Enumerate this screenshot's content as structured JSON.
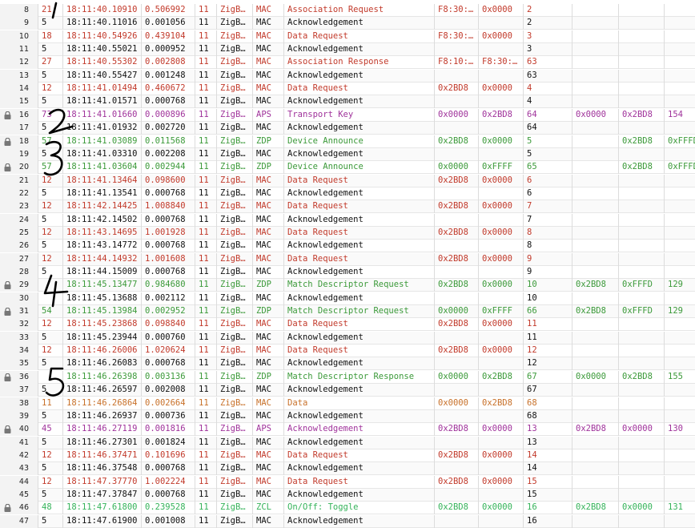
{
  "colors": {
    "mac_red": "#c23a2b",
    "mac_black": "#111111",
    "aps_purple": "#a0339b",
    "zdp_green": "#3c9a3a",
    "data_orange": "#c8712a",
    "zcl_green": "#35b35a",
    "ink": "#000000"
  },
  "icons": {
    "locked": "padlock-icon"
  },
  "rows": [
    {
      "idx": "8",
      "len": "21",
      "time": "18:11:40.10910",
      "dur": "0.506992",
      "ch": "11",
      "proto": "ZigB…",
      "layer": "MAC",
      "msg": "Association Request",
      "src": "F8:30:…",
      "dst": "0x0000",
      "seq": "2",
      "nsrc": "",
      "ndst": "",
      "rad": "",
      "color": "#c23a2b",
      "lock": false
    },
    {
      "idx": "9",
      "len": "5",
      "time": "18:11:40.11016",
      "dur": "0.001056",
      "ch": "11",
      "proto": "ZigB…",
      "layer": "MAC",
      "msg": "Acknowledgement",
      "src": "",
      "dst": "",
      "seq": "2",
      "nsrc": "",
      "ndst": "",
      "rad": "",
      "color": "#111111",
      "lock": false
    },
    {
      "idx": "10",
      "len": "18",
      "time": "18:11:40.54926",
      "dur": "0.439104",
      "ch": "11",
      "proto": "ZigB…",
      "layer": "MAC",
      "msg": "Data Request",
      "src": "F8:30:…",
      "dst": "0x0000",
      "seq": "3",
      "nsrc": "",
      "ndst": "",
      "rad": "",
      "color": "#c23a2b",
      "lock": false
    },
    {
      "idx": "11",
      "len": "5",
      "time": "18:11:40.55021",
      "dur": "0.000952",
      "ch": "11",
      "proto": "ZigB…",
      "layer": "MAC",
      "msg": "Acknowledgement",
      "src": "",
      "dst": "",
      "seq": "3",
      "nsrc": "",
      "ndst": "",
      "rad": "",
      "color": "#111111",
      "lock": false
    },
    {
      "idx": "12",
      "len": "27",
      "time": "18:11:40.55302",
      "dur": "0.002808",
      "ch": "11",
      "proto": "ZigB…",
      "layer": "MAC",
      "msg": "Association Response",
      "src": "F8:10:…",
      "dst": "F8:30:…",
      "seq": "63",
      "nsrc": "",
      "ndst": "",
      "rad": "",
      "color": "#c23a2b",
      "lock": false
    },
    {
      "idx": "13",
      "len": "5",
      "time": "18:11:40.55427",
      "dur": "0.001248",
      "ch": "11",
      "proto": "ZigB…",
      "layer": "MAC",
      "msg": "Acknowledgement",
      "src": "",
      "dst": "",
      "seq": "63",
      "nsrc": "",
      "ndst": "",
      "rad": "",
      "color": "#111111",
      "lock": false
    },
    {
      "idx": "14",
      "len": "12",
      "time": "18:11:41.01494",
      "dur": "0.460672",
      "ch": "11",
      "proto": "ZigB…",
      "layer": "MAC",
      "msg": "Data Request",
      "src": "0x2BD8",
      "dst": "0x0000",
      "seq": "4",
      "nsrc": "",
      "ndst": "",
      "rad": "",
      "color": "#c23a2b",
      "lock": false
    },
    {
      "idx": "15",
      "len": "5",
      "time": "18:11:41.01571",
      "dur": "0.000768",
      "ch": "11",
      "proto": "ZigB…",
      "layer": "MAC",
      "msg": "Acknowledgement",
      "src": "",
      "dst": "",
      "seq": "4",
      "nsrc": "",
      "ndst": "",
      "rad": "",
      "color": "#111111",
      "lock": false
    },
    {
      "idx": "16",
      "len": "73",
      "time": "18:11:41.01660",
      "dur": "0.000896",
      "ch": "11",
      "proto": "ZigB…",
      "layer": "APS",
      "msg": "Transport Key",
      "src": "0x0000",
      "dst": "0x2BD8",
      "seq": "64",
      "nsrc": "0x0000",
      "ndst": "0x2BD8",
      "rad": "154",
      "color": "#a0339b",
      "lock": true
    },
    {
      "idx": "17",
      "len": "5",
      "time": "18:11:41.01932",
      "dur": "0.002720",
      "ch": "11",
      "proto": "ZigB…",
      "layer": "MAC",
      "msg": "Acknowledgement",
      "src": "",
      "dst": "",
      "seq": "64",
      "nsrc": "",
      "ndst": "",
      "rad": "",
      "color": "#111111",
      "lock": false
    },
    {
      "idx": "18",
      "len": "57",
      "time": "18:11:41.03089",
      "dur": "0.011568",
      "ch": "11",
      "proto": "ZigB…",
      "layer": "ZDP",
      "msg": "Device Announce",
      "src": "0x2BD8",
      "dst": "0x0000",
      "seq": "5",
      "nsrc": "",
      "ndst": "0x2BD8",
      "rad": "0xFFFD",
      "color": "#3c9a3a",
      "lock": true
    },
    {
      "idx": "19",
      "len": "5",
      "time": "18:11:41.03310",
      "dur": "0.002208",
      "ch": "11",
      "proto": "ZigB…",
      "layer": "MAC",
      "msg": "Acknowledgement",
      "src": "",
      "dst": "",
      "seq": "5",
      "nsrc": "",
      "ndst": "",
      "rad": "",
      "color": "#111111",
      "lock": false
    },
    {
      "idx": "20",
      "len": "57",
      "time": "18:11:41.03604",
      "dur": "0.002944",
      "ch": "11",
      "proto": "ZigB…",
      "layer": "ZDP",
      "msg": "Device Announce",
      "src": "0x0000",
      "dst": "0xFFFF",
      "seq": "65",
      "nsrc": "",
      "ndst": "0x2BD8",
      "rad": "0xFFFD",
      "color": "#3c9a3a",
      "lock": true
    },
    {
      "idx": "21",
      "len": "12",
      "time": "18:11:41.13464",
      "dur": "0.098600",
      "ch": "11",
      "proto": "ZigB…",
      "layer": "MAC",
      "msg": "Data Request",
      "src": "0x2BD8",
      "dst": "0x0000",
      "seq": "6",
      "nsrc": "",
      "ndst": "",
      "rad": "",
      "color": "#c23a2b",
      "lock": false
    },
    {
      "idx": "22",
      "len": "5",
      "time": "18:11:41.13541",
      "dur": "0.000768",
      "ch": "11",
      "proto": "ZigB…",
      "layer": "MAC",
      "msg": "Acknowledgement",
      "src": "",
      "dst": "",
      "seq": "6",
      "nsrc": "",
      "ndst": "",
      "rad": "",
      "color": "#111111",
      "lock": false
    },
    {
      "idx": "23",
      "len": "12",
      "time": "18:11:42.14425",
      "dur": "1.008840",
      "ch": "11",
      "proto": "ZigB…",
      "layer": "MAC",
      "msg": "Data Request",
      "src": "0x2BD8",
      "dst": "0x0000",
      "seq": "7",
      "nsrc": "",
      "ndst": "",
      "rad": "",
      "color": "#c23a2b",
      "lock": false
    },
    {
      "idx": "24",
      "len": "5",
      "time": "18:11:42.14502",
      "dur": "0.000768",
      "ch": "11",
      "proto": "ZigB…",
      "layer": "MAC",
      "msg": "Acknowledgement",
      "src": "",
      "dst": "",
      "seq": "7",
      "nsrc": "",
      "ndst": "",
      "rad": "",
      "color": "#111111",
      "lock": false
    },
    {
      "idx": "25",
      "len": "12",
      "time": "18:11:43.14695",
      "dur": "1.001928",
      "ch": "11",
      "proto": "ZigB…",
      "layer": "MAC",
      "msg": "Data Request",
      "src": "0x2BD8",
      "dst": "0x0000",
      "seq": "8",
      "nsrc": "",
      "ndst": "",
      "rad": "",
      "color": "#c23a2b",
      "lock": false
    },
    {
      "idx": "26",
      "len": "5",
      "time": "18:11:43.14772",
      "dur": "0.000768",
      "ch": "11",
      "proto": "ZigB…",
      "layer": "MAC",
      "msg": "Acknowledgement",
      "src": "",
      "dst": "",
      "seq": "8",
      "nsrc": "",
      "ndst": "",
      "rad": "",
      "color": "#111111",
      "lock": false
    },
    {
      "idx": "27",
      "len": "12",
      "time": "18:11:44.14932",
      "dur": "1.001608",
      "ch": "11",
      "proto": "ZigB…",
      "layer": "MAC",
      "msg": "Data Request",
      "src": "0x2BD8",
      "dst": "0x0000",
      "seq": "9",
      "nsrc": "",
      "ndst": "",
      "rad": "",
      "color": "#c23a2b",
      "lock": false
    },
    {
      "idx": "28",
      "len": "5",
      "time": "18:11:44.15009",
      "dur": "0.000768",
      "ch": "11",
      "proto": "ZigB…",
      "layer": "MAC",
      "msg": "Acknowledgement",
      "src": "",
      "dst": "",
      "seq": "9",
      "nsrc": "",
      "ndst": "",
      "rad": "",
      "color": "#111111",
      "lock": false
    },
    {
      "idx": "29",
      "len": "",
      "time": "18:11:45.13477",
      "dur": "0.984680",
      "ch": "11",
      "proto": "ZigB…",
      "layer": "ZDP",
      "msg": "Match Descriptor Request",
      "src": "0x2BD8",
      "dst": "0x0000",
      "seq": "10",
      "nsrc": "0x2BD8",
      "ndst": "0xFFFD",
      "rad": "129",
      "color": "#3c9a3a",
      "lock": true
    },
    {
      "idx": "30",
      "len": "",
      "time": "18:11:45.13688",
      "dur": "0.002112",
      "ch": "11",
      "proto": "ZigB…",
      "layer": "MAC",
      "msg": "Acknowledgement",
      "src": "",
      "dst": "",
      "seq": "10",
      "nsrc": "",
      "ndst": "",
      "rad": "",
      "color": "#111111",
      "lock": false
    },
    {
      "idx": "31",
      "len": "54",
      "time": "18:11:45.13984",
      "dur": "0.002952",
      "ch": "11",
      "proto": "ZigB…",
      "layer": "ZDP",
      "msg": "Match Descriptor Request",
      "src": "0x0000",
      "dst": "0xFFFF",
      "seq": "66",
      "nsrc": "0x2BD8",
      "ndst": "0xFFFD",
      "rad": "129",
      "color": "#3c9a3a",
      "lock": true
    },
    {
      "idx": "32",
      "len": "12",
      "time": "18:11:45.23868",
      "dur": "0.098840",
      "ch": "11",
      "proto": "ZigB…",
      "layer": "MAC",
      "msg": "Data Request",
      "src": "0x2BD8",
      "dst": "0x0000",
      "seq": "11",
      "nsrc": "",
      "ndst": "",
      "rad": "",
      "color": "#c23a2b",
      "lock": false
    },
    {
      "idx": "33",
      "len": "5",
      "time": "18:11:45.23944",
      "dur": "0.000760",
      "ch": "11",
      "proto": "ZigB…",
      "layer": "MAC",
      "msg": "Acknowledgement",
      "src": "",
      "dst": "",
      "seq": "11",
      "nsrc": "",
      "ndst": "",
      "rad": "",
      "color": "#111111",
      "lock": false
    },
    {
      "idx": "34",
      "len": "12",
      "time": "18:11:46.26006",
      "dur": "1.020624",
      "ch": "11",
      "proto": "ZigB…",
      "layer": "MAC",
      "msg": "Data Request",
      "src": "0x2BD8",
      "dst": "0x0000",
      "seq": "12",
      "nsrc": "",
      "ndst": "",
      "rad": "",
      "color": "#c23a2b",
      "lock": false
    },
    {
      "idx": "35",
      "len": "5",
      "time": "18:11:46.26083",
      "dur": "0.000768",
      "ch": "11",
      "proto": "ZigB…",
      "layer": "MAC",
      "msg": "Acknowledgement",
      "src": "",
      "dst": "",
      "seq": "12",
      "nsrc": "",
      "ndst": "",
      "rad": "",
      "color": "#111111",
      "lock": false
    },
    {
      "idx": "36",
      "len": "",
      "time": "18:11:46.26398",
      "dur": "0.003136",
      "ch": "11",
      "proto": "ZigB…",
      "layer": "ZDP",
      "msg": "Match Descriptor Response",
      "src": "0x0000",
      "dst": "0x2BD8",
      "seq": "67",
      "nsrc": "0x0000",
      "ndst": "0x2BD8",
      "rad": "155",
      "color": "#3c9a3a",
      "lock": true
    },
    {
      "idx": "37",
      "len": "5",
      "time": "18:11:46.26597",
      "dur": "0.002008",
      "ch": "11",
      "proto": "ZigB…",
      "layer": "MAC",
      "msg": "Acknowledgement",
      "src": "",
      "dst": "",
      "seq": "67",
      "nsrc": "",
      "ndst": "",
      "rad": "",
      "color": "#111111",
      "lock": false
    },
    {
      "idx": "38",
      "len": "11",
      "time": "18:11:46.26864",
      "dur": "0.002664",
      "ch": "11",
      "proto": "ZigB…",
      "layer": "MAC",
      "msg": "Data",
      "src": "0x0000",
      "dst": "0x2BD8",
      "seq": "68",
      "nsrc": "",
      "ndst": "",
      "rad": "",
      "color": "#c8712a",
      "lock": false
    },
    {
      "idx": "39",
      "len": "5",
      "time": "18:11:46.26937",
      "dur": "0.000736",
      "ch": "11",
      "proto": "ZigB…",
      "layer": "MAC",
      "msg": "Acknowledgement",
      "src": "",
      "dst": "",
      "seq": "68",
      "nsrc": "",
      "ndst": "",
      "rad": "",
      "color": "#111111",
      "lock": false
    },
    {
      "idx": "40",
      "len": "45",
      "time": "18:11:46.27119",
      "dur": "0.001816",
      "ch": "11",
      "proto": "ZigB…",
      "layer": "APS",
      "msg": "Acknowledgement",
      "src": "0x2BD8",
      "dst": "0x0000",
      "seq": "13",
      "nsrc": "0x2BD8",
      "ndst": "0x0000",
      "rad": "130",
      "color": "#a0339b",
      "lock": true
    },
    {
      "idx": "41",
      "len": "5",
      "time": "18:11:46.27301",
      "dur": "0.001824",
      "ch": "11",
      "proto": "ZigB…",
      "layer": "MAC",
      "msg": "Acknowledgement",
      "src": "",
      "dst": "",
      "seq": "13",
      "nsrc": "",
      "ndst": "",
      "rad": "",
      "color": "#111111",
      "lock": false
    },
    {
      "idx": "42",
      "len": "12",
      "time": "18:11:46.37471",
      "dur": "0.101696",
      "ch": "11",
      "proto": "ZigB…",
      "layer": "MAC",
      "msg": "Data Request",
      "src": "0x2BD8",
      "dst": "0x0000",
      "seq": "14",
      "nsrc": "",
      "ndst": "",
      "rad": "",
      "color": "#c23a2b",
      "lock": false
    },
    {
      "idx": "43",
      "len": "5",
      "time": "18:11:46.37548",
      "dur": "0.000768",
      "ch": "11",
      "proto": "ZigB…",
      "layer": "MAC",
      "msg": "Acknowledgement",
      "src": "",
      "dst": "",
      "seq": "14",
      "nsrc": "",
      "ndst": "",
      "rad": "",
      "color": "#111111",
      "lock": false
    },
    {
      "idx": "44",
      "len": "12",
      "time": "18:11:47.37770",
      "dur": "1.002224",
      "ch": "11",
      "proto": "ZigB…",
      "layer": "MAC",
      "msg": "Data Request",
      "src": "0x2BD8",
      "dst": "0x0000",
      "seq": "15",
      "nsrc": "",
      "ndst": "",
      "rad": "",
      "color": "#c23a2b",
      "lock": false
    },
    {
      "idx": "45",
      "len": "5",
      "time": "18:11:47.37847",
      "dur": "0.000768",
      "ch": "11",
      "proto": "ZigB…",
      "layer": "MAC",
      "msg": "Acknowledgement",
      "src": "",
      "dst": "",
      "seq": "15",
      "nsrc": "",
      "ndst": "",
      "rad": "",
      "color": "#111111",
      "lock": false
    },
    {
      "idx": "46",
      "len": "48",
      "time": "18:11:47.61800",
      "dur": "0.239528",
      "ch": "11",
      "proto": "ZigB…",
      "layer": "ZCL",
      "msg": "On/Off: Toggle",
      "src": "0x2BD8",
      "dst": "0x0000",
      "seq": "16",
      "nsrc": "0x2BD8",
      "ndst": "0x0000",
      "rad": "131",
      "color": "#35b35a",
      "lock": true
    },
    {
      "idx": "47",
      "len": "5",
      "time": "18:11:47.61900",
      "dur": "0.001008",
      "ch": "11",
      "proto": "ZigB…",
      "layer": "MAC",
      "msg": "Acknowledgement",
      "src": "",
      "dst": "",
      "seq": "16",
      "nsrc": "",
      "ndst": "",
      "rad": "",
      "color": "#111111",
      "lock": false
    }
  ]
}
